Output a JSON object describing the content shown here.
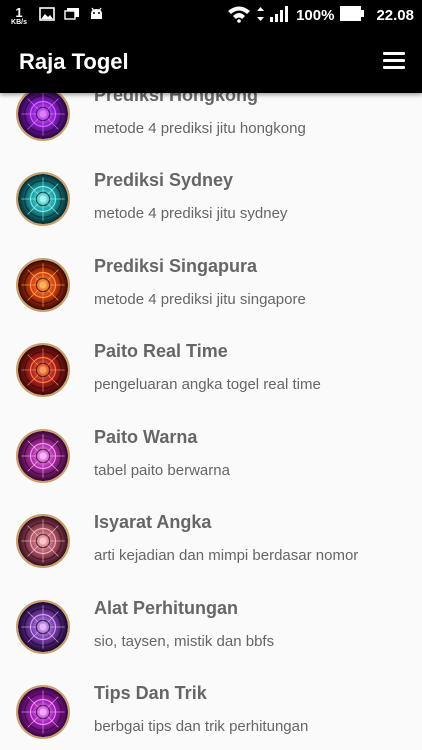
{
  "status_bar": {
    "net_speed_value": "1",
    "net_speed_unit": "KB/s",
    "battery": "100%",
    "time": "22.08"
  },
  "app_bar": {
    "title": "Raja Togel"
  },
  "menu": {
    "items": [
      {
        "title": "Prediksi Hongkong",
        "subtitle": "metode 4 prediksi jitu hongkong",
        "icon": "purple-mandala-icon"
      },
      {
        "title": "Prediksi Sydney",
        "subtitle": "metode 4 prediksi jitu sydney",
        "icon": "teal-mandala-icon"
      },
      {
        "title": "Prediksi Singapura",
        "subtitle": "metode 4 prediksi jitu singapore",
        "icon": "orange-mandala-icon"
      },
      {
        "title": "Paito Real Time",
        "subtitle": "pengeluaran angka togel real time",
        "icon": "red-mandala-icon"
      },
      {
        "title": "Paito Warna",
        "subtitle": "tabel paito berwarna",
        "icon": "pink-mandala-icon"
      },
      {
        "title": "Isyarat Angka",
        "subtitle": "arti kejadian dan mimpi berdasar nomor",
        "icon": "rose-mandala-icon"
      },
      {
        "title": "Alat Perhitungan",
        "subtitle": "sio, taysen, mistik dan bbfs",
        "icon": "violet-mandala-icon"
      },
      {
        "title": "Tips Dan Trik",
        "subtitle": "berbgai tips  dan trik perhitungan",
        "icon": "magenta-mandala-icon"
      }
    ]
  },
  "colors": {
    "app_bar": "#000000",
    "background": "#fafafa",
    "text": "#666666",
    "icon_palettes": [
      [
        "#e27cff",
        "#8a1fd0",
        "#2a0640"
      ],
      [
        "#9ff7f0",
        "#1aa3a8",
        "#062a2e"
      ],
      [
        "#ffb25a",
        "#d8400f",
        "#3a0a04"
      ],
      [
        "#ff9b5a",
        "#b5211f",
        "#3a0806"
      ],
      [
        "#ffb3ff",
        "#b02fa8",
        "#3a0630"
      ],
      [
        "#ffc4c8",
        "#b0586a",
        "#3a1020"
      ],
      [
        "#e3b8ff",
        "#7a3fb0",
        "#1c0630"
      ],
      [
        "#f7a6ff",
        "#a01fb5",
        "#3a0640"
      ]
    ]
  }
}
